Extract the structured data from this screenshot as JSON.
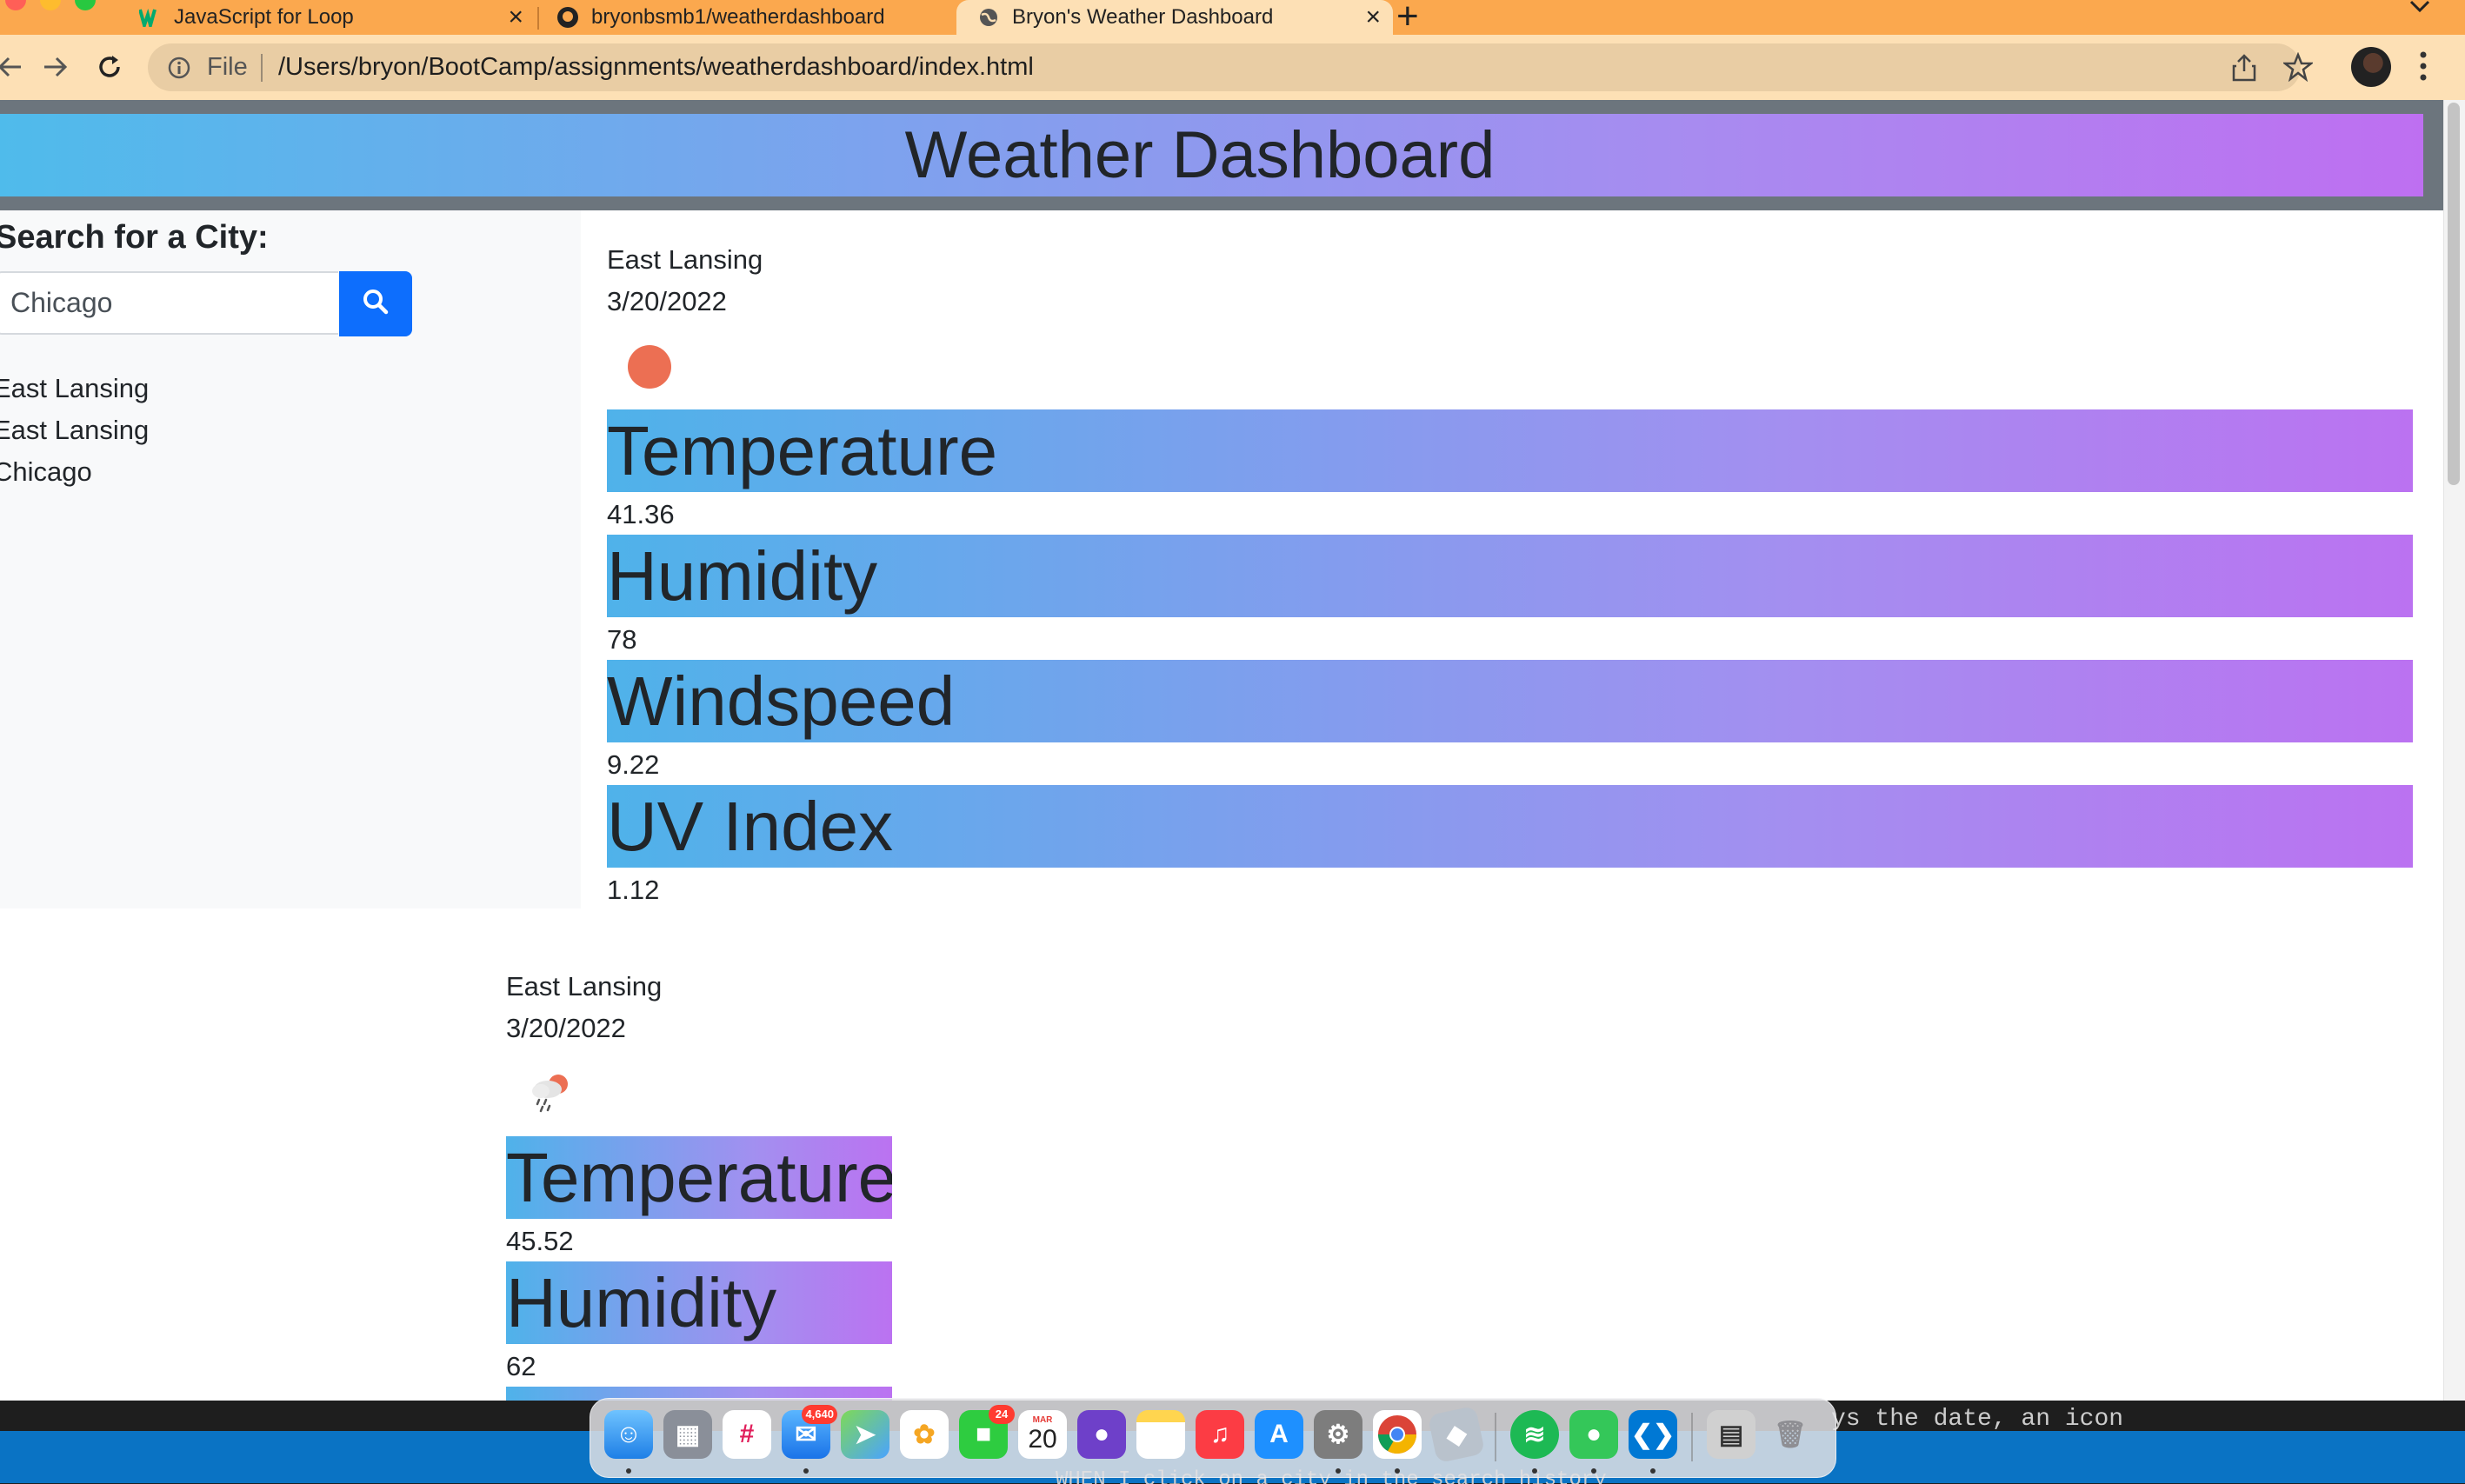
{
  "browser": {
    "tabs": [
      {
        "title": "JavaScript for Loop",
        "icon": "w3schools-icon",
        "active": false
      },
      {
        "title": "bryonbsmb1/weatherdashboard",
        "icon": "github-icon",
        "active": false
      },
      {
        "title": "Bryon's Weather Dashboard",
        "icon": "globe-icon",
        "active": true
      }
    ],
    "new_tab_label": "+",
    "scheme_label": "File",
    "url": "/Users/bryon/BootCamp/assignments/weatherdashboard/index.html"
  },
  "page": {
    "title": "Weather Dashboard",
    "search": {
      "label": "Search for a City:",
      "value": "Chicago",
      "button_icon": "search-icon"
    },
    "history": [
      "East Lansing",
      "East Lansing",
      "Chicago"
    ],
    "current": {
      "city": "East Lansing",
      "date": "3/20/2022",
      "icon": "red-dot-weather-icon",
      "metrics": [
        {
          "label": "Temperature",
          "value": "41.36"
        },
        {
          "label": "Humidity",
          "value": "78"
        },
        {
          "label": "Windspeed",
          "value": "9.22"
        },
        {
          "label": "UV Index",
          "value": "1.12"
        }
      ]
    },
    "forecast": {
      "city": "East Lansing",
      "date": "3/20/2022",
      "icon": "rain-cloud-icon",
      "metrics": [
        {
          "label": "Temperature",
          "value": "45.52"
        },
        {
          "label": "Humidity",
          "value": "62"
        }
      ]
    }
  },
  "desktop": {
    "terminal_text": "ys the date, an icon",
    "terminal_text_2": "WHEN I click on a city in the search history",
    "dock_badges": {
      "mail": "4,640",
      "facetime": "24"
    },
    "calendar": {
      "month": "MAR",
      "day": "20"
    }
  },
  "colors": {
    "tabbar": "#fba84e",
    "toolbar": "#fde0b5",
    "gradient_start": "#4fbbeb",
    "gradient_end": "#be6ff1",
    "search_button": "#0d6efd",
    "header_border": "#6c757d"
  }
}
